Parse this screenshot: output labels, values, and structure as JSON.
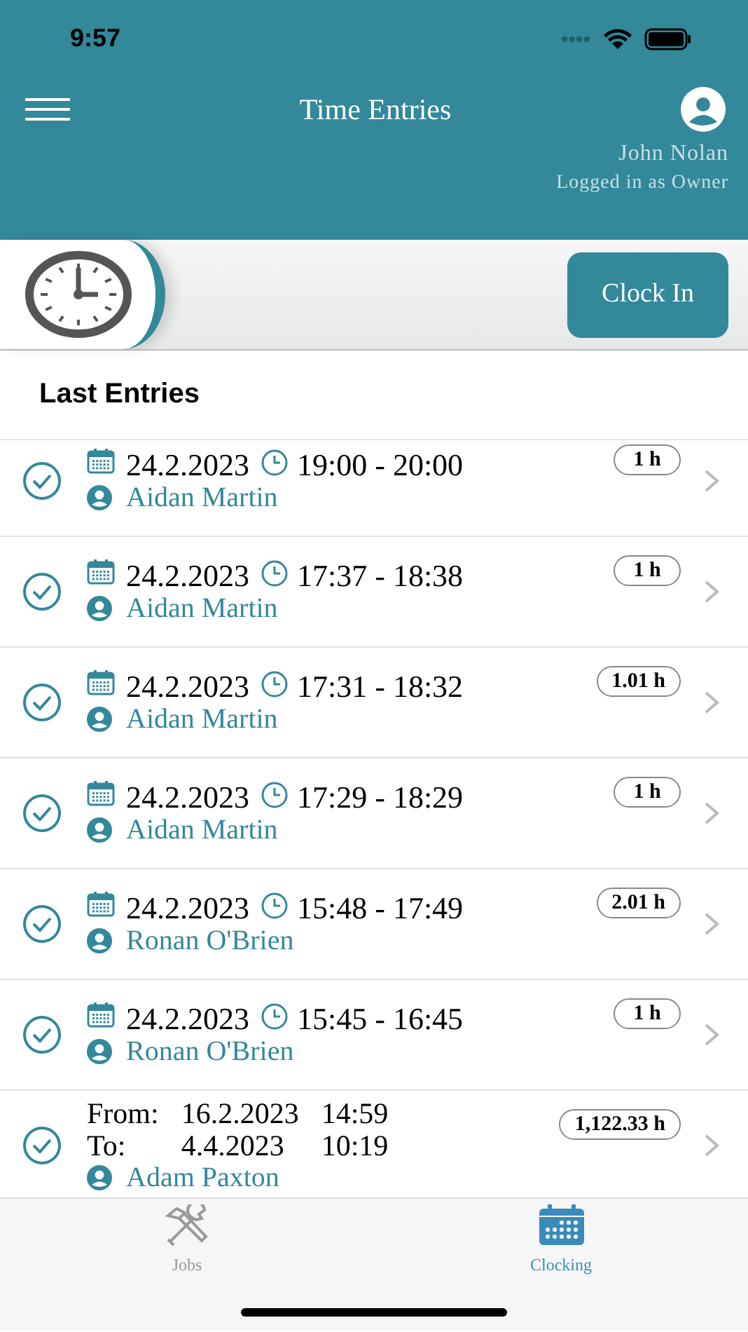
{
  "status_bar": {
    "time": "9:57"
  },
  "header": {
    "title": "Time Entries",
    "user_name": "John Nolan",
    "user_role": "Logged in as Owner"
  },
  "clock_in_button": "Clock In",
  "section_title": "Last Entries",
  "entries": [
    {
      "kind": "single",
      "date": "24.2.2023",
      "time": "19:00 - 20:00",
      "name": "Aidan Martin",
      "hours": "1 h"
    },
    {
      "kind": "single",
      "date": "24.2.2023",
      "time": "17:37 - 18:38",
      "name": "Aidan Martin",
      "hours": "1 h"
    },
    {
      "kind": "single",
      "date": "24.2.2023",
      "time": "17:31 - 18:32",
      "name": "Aidan Martin",
      "hours": "1.01 h"
    },
    {
      "kind": "single",
      "date": "24.2.2023",
      "time": "17:29 - 18:29",
      "name": "Aidan Martin",
      "hours": "1 h"
    },
    {
      "kind": "single",
      "date": "24.2.2023",
      "time": "15:48 - 17:49",
      "name": "Ronan O'Brien",
      "hours": "2.01 h"
    },
    {
      "kind": "single",
      "date": "24.2.2023",
      "time": "15:45 - 16:45",
      "name": "Ronan O'Brien",
      "hours": "1 h"
    },
    {
      "kind": "range",
      "from_label": "From:",
      "from_date": "16.2.2023",
      "from_time": "14:59",
      "to_label": "To:",
      "to_date": "4.4.2023",
      "to_time": "10:19",
      "name": "Adam Paxton",
      "hours": "1,122.33 h"
    }
  ],
  "tabs": [
    {
      "kind": "tools",
      "label": "Jobs",
      "selected": false
    },
    {
      "kind": "calendar",
      "label": "Clocking",
      "selected": true
    }
  ]
}
